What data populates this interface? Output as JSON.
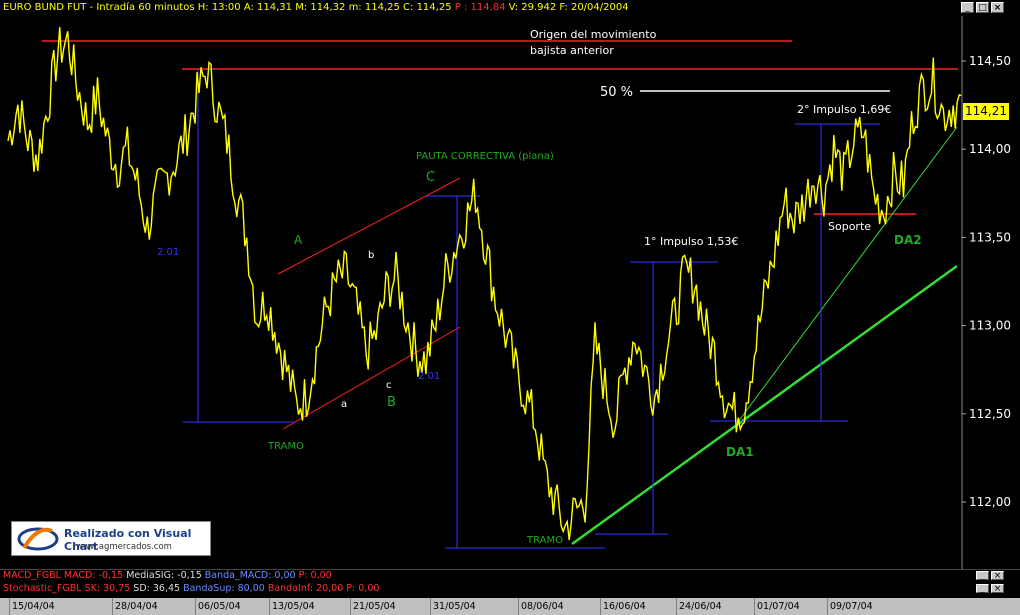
{
  "header": {
    "instrument": "EURO BUND FUT - Intradía 60 minutos",
    "fields": [
      {
        "label": "H:",
        "value": "13:00",
        "color": "#ffff00"
      },
      {
        "label": "A:",
        "value": "114,31",
        "color": "#ffff00"
      },
      {
        "label": "M:",
        "value": "114,32",
        "color": "#ffff00"
      },
      {
        "label": "m:",
        "value": "114,25",
        "color": "#ffff00"
      },
      {
        "label": "C:",
        "value": "114,25",
        "color": "#ffff00"
      },
      {
        "label": "P :",
        "value": "114,84",
        "color": "#ff3030"
      },
      {
        "label": "V:",
        "value": "29.942",
        "color": "#ffff00"
      },
      {
        "label": "F:",
        "value": "20/04/2004",
        "color": "#ffff00"
      }
    ]
  },
  "window_buttons": [
    "_",
    "□",
    "×"
  ],
  "indicators": {
    "macd": [
      {
        "text": "MACD_FGBL",
        "color": "#ff3030"
      },
      {
        "text": " MACD: -0,15",
        "color": "#ff3030"
      },
      {
        "text": "  MediaSIG: -0,15",
        "color": "#dddddd"
      },
      {
        "text": "  Banda_MACD: 0,00",
        "color": "#6b8cff"
      },
      {
        "text": "  P: 0,00",
        "color": "#ff3030"
      }
    ],
    "stochastic": [
      {
        "text": "Stochastic_FGBL",
        "color": "#ff3030"
      },
      {
        "text": " SK: 30,75",
        "color": "#ff3030"
      },
      {
        "text": "  SD: 36,45",
        "color": "#dddddd"
      },
      {
        "text": "  BandaSup: 80,00",
        "color": "#6b8cff"
      },
      {
        "text": "  BandaInf: 20,00",
        "color": "#ff3030"
      },
      {
        "text": "  P: 0,00",
        "color": "#ff3030"
      }
    ]
  },
  "logo": {
    "title": "Realizado con Visual Chart",
    "url": "www.agmercados.com"
  },
  "last_price": "114,21",
  "chart_data": {
    "type": "line",
    "y_axis": {
      "ticks": [
        "114,50",
        "114,00",
        "113,50",
        "113,00",
        "112,50",
        "112,00"
      ],
      "range": [
        111.7,
        114.9
      ]
    },
    "x_axis": {
      "ticks": [
        "15/04/04",
        "28/04/04",
        "06/05/04",
        "13/05/04",
        "21/05/04",
        "31/05/04",
        "08/06/04",
        "16/06/04",
        "24/06/04",
        "01/07/04",
        "09/07/04"
      ]
    },
    "series": [
      {
        "color": "#ffff00",
        "points": [
          [
            0,
            114.05
          ],
          [
            1,
            114.25
          ],
          [
            2,
            114.05
          ],
          [
            3,
            113.95
          ],
          [
            4,
            114.25
          ],
          [
            5,
            114.55
          ],
          [
            6,
            114.62
          ],
          [
            7,
            114.35
          ],
          [
            8,
            114.15
          ],
          [
            9,
            114.3
          ],
          [
            10,
            114.05
          ],
          [
            11,
            113.9
          ],
          [
            12,
            114.0
          ],
          [
            13,
            113.8
          ],
          [
            14,
            113.55
          ],
          [
            15,
            113.75
          ],
          [
            16,
            113.85
          ],
          [
            17,
            113.95
          ],
          [
            18,
            114.1
          ],
          [
            19,
            114.3
          ],
          [
            20,
            114.45
          ],
          [
            21,
            114.25
          ],
          [
            22,
            114.05
          ],
          [
            23,
            113.75
          ],
          [
            24,
            113.5
          ],
          [
            25,
            113.05
          ],
          [
            26,
            113.15
          ],
          [
            27,
            112.95
          ],
          [
            28,
            112.75
          ],
          [
            29,
            112.55
          ],
          [
            30,
            112.6
          ],
          [
            31,
            112.85
          ],
          [
            32,
            113.1
          ],
          [
            33,
            113.25
          ],
          [
            34,
            113.3
          ],
          [
            35,
            113.1
          ],
          [
            36,
            112.85
          ],
          [
            37,
            112.95
          ],
          [
            38,
            113.2
          ],
          [
            39,
            113.28
          ],
          [
            40,
            113.05
          ],
          [
            41,
            112.85
          ],
          [
            42,
            112.8
          ],
          [
            43,
            113.0
          ],
          [
            44,
            113.3
          ],
          [
            45,
            113.45
          ],
          [
            46,
            113.6
          ],
          [
            47,
            113.75
          ],
          [
            48,
            113.45
          ],
          [
            49,
            113.15
          ],
          [
            50,
            112.95
          ],
          [
            51,
            112.75
          ],
          [
            52,
            112.6
          ],
          [
            53,
            112.45
          ],
          [
            54,
            112.15
          ],
          [
            55,
            112.0
          ],
          [
            56,
            111.85
          ],
          [
            57,
            111.95
          ],
          [
            58,
            112.0
          ],
          [
            59,
            112.9
          ],
          [
            60,
            112.65
          ],
          [
            61,
            112.45
          ],
          [
            62,
            112.75
          ],
          [
            63,
            112.95
          ],
          [
            64,
            112.75
          ],
          [
            65,
            112.6
          ],
          [
            66,
            112.85
          ],
          [
            67,
            113.05
          ],
          [
            68,
            113.3
          ],
          [
            69,
            113.25
          ],
          [
            70,
            113.0
          ],
          [
            71,
            112.85
          ],
          [
            72,
            112.6
          ],
          [
            73,
            112.5
          ],
          [
            74,
            112.55
          ],
          [
            75,
            112.85
          ],
          [
            76,
            113.15
          ],
          [
            77,
            113.4
          ],
          [
            78,
            113.7
          ],
          [
            79,
            113.6
          ],
          [
            80,
            113.7
          ],
          [
            81,
            113.85
          ],
          [
            82,
            113.75
          ],
          [
            83,
            114.0
          ],
          [
            84,
            113.85
          ],
          [
            85,
            114.05
          ],
          [
            86,
            114.1
          ],
          [
            87,
            113.75
          ],
          [
            88,
            113.65
          ],
          [
            89,
            113.85
          ],
          [
            90,
            113.8
          ],
          [
            91,
            114.2
          ],
          [
            92,
            114.35
          ],
          [
            93,
            114.38
          ],
          [
            94,
            114.2
          ],
          [
            95,
            114.25
          ]
        ]
      }
    ],
    "annotations": {
      "origin_text_1": "Origen del movimiento",
      "origin_text_2": "bajista anterior",
      "fifty": "50 %",
      "impulse2": "2° Impulso 1,69€",
      "impulse1": "1° Impulso 1,53€",
      "pauta": "PAUTA CORRECTIVA (plana)",
      "C": "C",
      "A": "A",
      "b": "b",
      "a": "a",
      "c": "c",
      "B": "B",
      "dist_left": "2.01",
      "dist_mid": "2.01",
      "tramo1": "TRAMO",
      "tramo2": "TRAMO",
      "soporte": "Soporte",
      "DA1": "DA1",
      "DA2": "DA2"
    }
  }
}
